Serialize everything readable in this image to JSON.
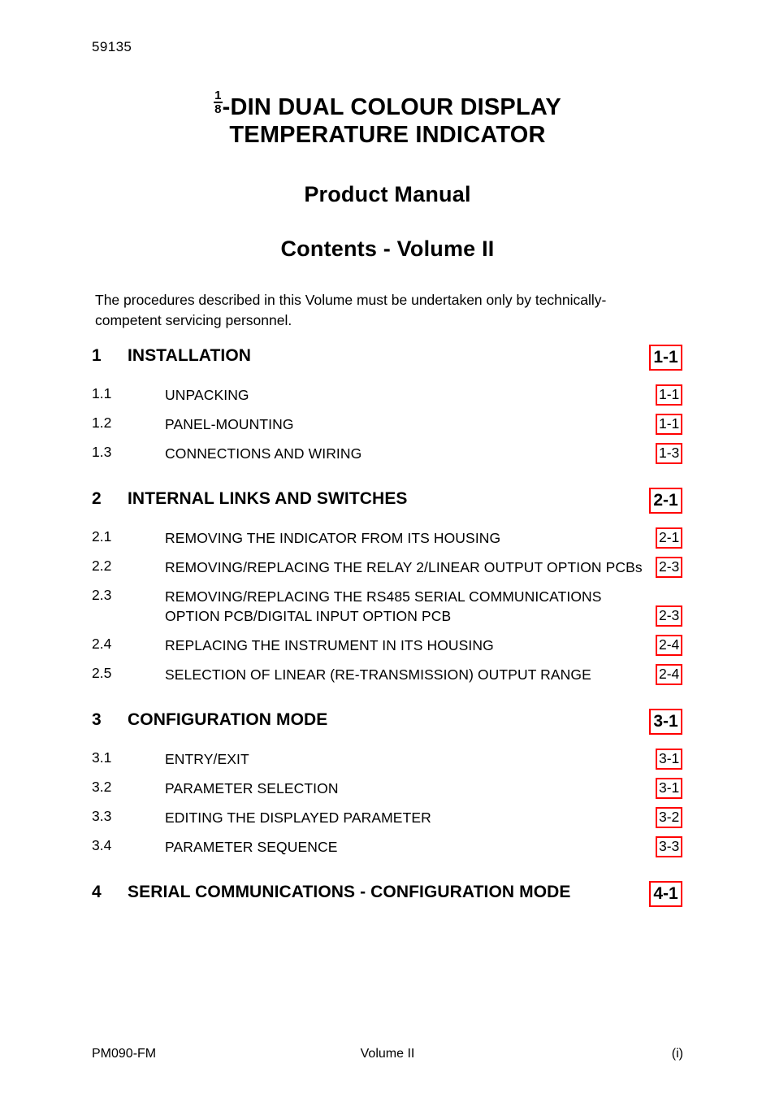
{
  "header": {
    "doc_number": "59135"
  },
  "title": {
    "fraction_numerator": "1",
    "fraction_denominator": "8",
    "line1_rest": "-DIN DUAL COLOUR DISPLAY",
    "line2": "TEMPERATURE INDICATOR",
    "product_manual": "Product Manual",
    "contents": "Contents - Volume II"
  },
  "intro": {
    "text": "The procedures described in this Volume must be undertaken only by technically-competent servicing personnel."
  },
  "toc": {
    "entries": [
      {
        "level": 1,
        "number": "1",
        "label": "INSTALLATION",
        "page": "1-1"
      },
      {
        "level": 2,
        "number": "1.1",
        "label": "UNPACKING",
        "page": "1-1"
      },
      {
        "level": 2,
        "number": "1.2",
        "label": "PANEL-MOUNTING",
        "page": "1-1"
      },
      {
        "level": 2,
        "number": "1.3",
        "label": "CONNECTIONS AND WIRING",
        "page": "1-3"
      },
      {
        "level": 1,
        "number": "2",
        "label": "INTERNAL LINKS AND SWITCHES",
        "page": "2-1"
      },
      {
        "level": 2,
        "number": "2.1",
        "label": "REMOVING THE INDICATOR FROM ITS HOUSING",
        "page": "2-1"
      },
      {
        "level": 2,
        "number": "2.2",
        "label": "REMOVING/REPLACING THE RELAY 2/LINEAR OUTPUT OPTION PCBs",
        "page": "2-3"
      },
      {
        "level": 2,
        "number": "2.3",
        "label": "REMOVING/REPLACING THE RS485 SERIAL COMMUNICATIONS OPTION PCB/DIGITAL INPUT OPTION PCB",
        "page": "2-3",
        "two_line": true
      },
      {
        "level": 2,
        "number": "2.4",
        "label": "REPLACING THE INSTRUMENT IN ITS HOUSING",
        "page": "2-4"
      },
      {
        "level": 2,
        "number": "2.5",
        "label": "SELECTION OF LINEAR (RE-TRANSMISSION) OUTPUT RANGE",
        "page": "2-4"
      },
      {
        "level": 1,
        "number": "3",
        "label": "CONFIGURATION MODE",
        "page": "3-1"
      },
      {
        "level": 2,
        "number": "3.1",
        "label": "ENTRY/EXIT",
        "page": "3-1"
      },
      {
        "level": 2,
        "number": "3.2",
        "label": "PARAMETER SELECTION",
        "page": "3-1"
      },
      {
        "level": 2,
        "number": "3.3",
        "label": "EDITING THE DISPLAYED PARAMETER",
        "page": "3-2"
      },
      {
        "level": 2,
        "number": "3.4",
        "label": "PARAMETER SEQUENCE",
        "page": "3-3"
      },
      {
        "level": 1,
        "number": "4",
        "label": "SERIAL COMMUNICATIONS - CONFIGURATION MODE",
        "page": "4-1"
      }
    ]
  },
  "footer": {
    "left": "PM090-FM",
    "center": "Volume II",
    "right": "(i)"
  },
  "colors": {
    "page_box_border": "#ff0000",
    "text": "#000000",
    "background": "#ffffff"
  }
}
